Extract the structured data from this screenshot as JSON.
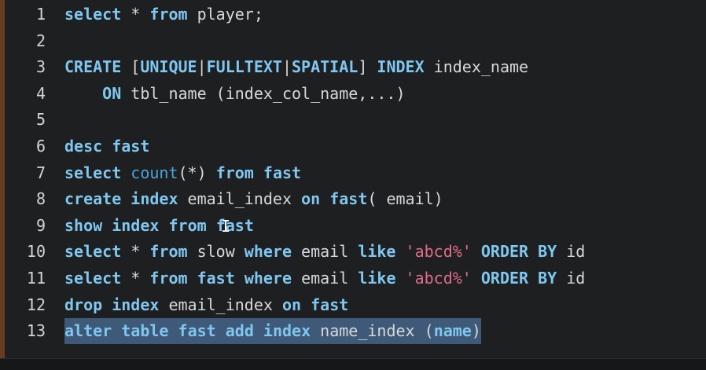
{
  "editor": {
    "lines": [
      {
        "number": "1",
        "tokens": [
          [
            "kw",
            "select"
          ],
          [
            "pl",
            " * "
          ],
          [
            "kw",
            "from"
          ],
          [
            "pl",
            " player;"
          ]
        ]
      },
      {
        "number": "2",
        "tokens": []
      },
      {
        "number": "3",
        "tokens": [
          [
            "kw",
            "CREATE"
          ],
          [
            "pl",
            " ["
          ],
          [
            "kw",
            "UNIQUE"
          ],
          [
            "pl",
            "|"
          ],
          [
            "kw",
            "FULLTEXT"
          ],
          [
            "pl",
            "|"
          ],
          [
            "kw",
            "SPATIAL"
          ],
          [
            "pl",
            "] "
          ],
          [
            "kw",
            "INDEX"
          ],
          [
            "pl",
            " index_name"
          ]
        ]
      },
      {
        "number": "4",
        "tokens": [
          [
            "pl",
            "    "
          ],
          [
            "kw",
            "ON"
          ],
          [
            "pl",
            " tbl_name (index_col_name,...)"
          ]
        ]
      },
      {
        "number": "5",
        "tokens": []
      },
      {
        "number": "6",
        "tokens": [
          [
            "kw",
            "desc"
          ],
          [
            "pl",
            " "
          ],
          [
            "kw",
            "fast"
          ]
        ]
      },
      {
        "number": "7",
        "tokens": [
          [
            "kw",
            "select"
          ],
          [
            "pl",
            " "
          ],
          [
            "fn",
            "count"
          ],
          [
            "pl",
            "(*) "
          ],
          [
            "kw",
            "from"
          ],
          [
            "pl",
            " "
          ],
          [
            "kw",
            "fast"
          ]
        ]
      },
      {
        "number": "8",
        "tokens": [
          [
            "kw",
            "create"
          ],
          [
            "pl",
            " "
          ],
          [
            "kw",
            "index"
          ],
          [
            "pl",
            " email_index "
          ],
          [
            "kw",
            "on"
          ],
          [
            "pl",
            " "
          ],
          [
            "kw",
            "fast"
          ],
          [
            "pl",
            "( email)"
          ]
        ]
      },
      {
        "number": "9",
        "tokens": [
          [
            "kw",
            "show"
          ],
          [
            "pl",
            " "
          ],
          [
            "kw",
            "index"
          ],
          [
            "pl",
            " "
          ],
          [
            "kw",
            "from"
          ],
          [
            "pl",
            " "
          ],
          [
            "kw",
            "fast"
          ]
        ]
      },
      {
        "number": "10",
        "tokens": [
          [
            "kw",
            "select"
          ],
          [
            "pl",
            " * "
          ],
          [
            "kw",
            "from"
          ],
          [
            "pl",
            " slow "
          ],
          [
            "kw",
            "where"
          ],
          [
            "pl",
            " email "
          ],
          [
            "kw",
            "like"
          ],
          [
            "pl",
            " "
          ],
          [
            "str",
            "'abcd%'"
          ],
          [
            "pl",
            " "
          ],
          [
            "kw",
            "ORDER BY"
          ],
          [
            "pl",
            " id"
          ]
        ]
      },
      {
        "number": "11",
        "tokens": [
          [
            "kw",
            "select"
          ],
          [
            "pl",
            " * "
          ],
          [
            "kw",
            "from"
          ],
          [
            "pl",
            " "
          ],
          [
            "kw",
            "fast"
          ],
          [
            "pl",
            " "
          ],
          [
            "kw",
            "where"
          ],
          [
            "pl",
            " email "
          ],
          [
            "kw",
            "like"
          ],
          [
            "pl",
            " "
          ],
          [
            "str",
            "'abcd%'"
          ],
          [
            "pl",
            " "
          ],
          [
            "kw",
            "ORDER BY"
          ],
          [
            "pl",
            " id"
          ]
        ]
      },
      {
        "number": "12",
        "tokens": [
          [
            "kw",
            "drop"
          ],
          [
            "pl",
            " "
          ],
          [
            "kw",
            "index"
          ],
          [
            "pl",
            " email_index "
          ],
          [
            "kw",
            "on"
          ],
          [
            "pl",
            " "
          ],
          [
            "kw",
            "fast"
          ]
        ]
      },
      {
        "number": "13",
        "selected": true,
        "tokens": [
          [
            "kw",
            "alter"
          ],
          [
            "pl",
            " "
          ],
          [
            "kw",
            "table"
          ],
          [
            "pl",
            " "
          ],
          [
            "kw",
            "fast"
          ],
          [
            "pl",
            " "
          ],
          [
            "kw",
            "add"
          ],
          [
            "pl",
            " "
          ],
          [
            "kw",
            "index"
          ],
          [
            "pl",
            " name_index ("
          ],
          [
            "kw",
            "name"
          ],
          [
            "pl",
            ")"
          ]
        ]
      }
    ],
    "mouse_cursor_glyph": "I"
  },
  "colors": {
    "background": "#1e1f21",
    "keyword": "#7fc7f0",
    "function": "#4aa3df",
    "string": "#e06c8a",
    "plain": "#d8d8d8",
    "selection": "#3f5a78"
  }
}
